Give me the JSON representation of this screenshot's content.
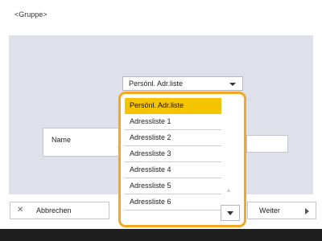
{
  "screen": {
    "title": "<Gruppe>"
  },
  "header_select": {
    "value": "Persönl. Adr.liste",
    "icon": "chevron-down-icon"
  },
  "name_button": {
    "label": "Name",
    "icon": "chevron-right-icon"
  },
  "bottom": {
    "cancel_label": "Abbrechen",
    "cancel_icon": "close-icon",
    "next_label": "Weiter",
    "next_icon": "play-icon"
  },
  "dropdown": {
    "accent": "#f5a623",
    "selected_color": "#f5c400",
    "options": [
      "Persönl. Adr.liste",
      "Adressliste 1",
      "Adressliste 2",
      "Adressliste 3",
      "Adressliste 4",
      "Adressliste 5",
      "Adressliste 6"
    ],
    "selected_index": 0
  }
}
